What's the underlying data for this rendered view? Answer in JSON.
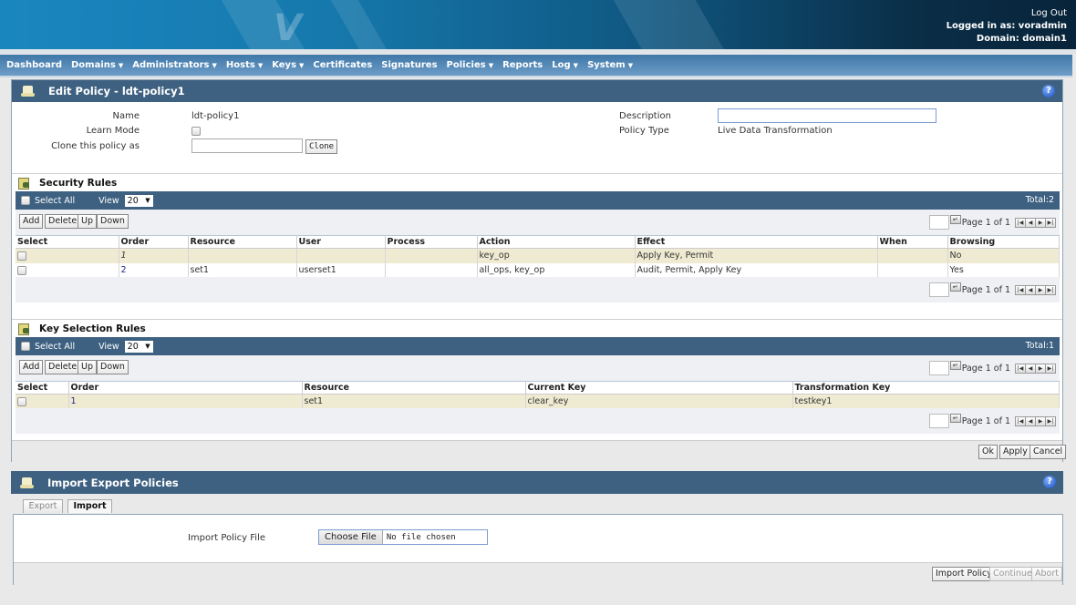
{
  "header": {
    "logout": "Log Out",
    "logged_in": "Logged in as: voradmin",
    "domain": "Domain: domain1"
  },
  "nav": {
    "items": [
      {
        "label": "Dashboard",
        "dropdown": false
      },
      {
        "label": "Domains",
        "dropdown": true
      },
      {
        "label": "Administrators",
        "dropdown": true
      },
      {
        "label": "Hosts",
        "dropdown": true
      },
      {
        "label": "Keys",
        "dropdown": true
      },
      {
        "label": "Certificates",
        "dropdown": false
      },
      {
        "label": "Signatures",
        "dropdown": false
      },
      {
        "label": "Policies",
        "dropdown": true
      },
      {
        "label": "Reports",
        "dropdown": false
      },
      {
        "label": "Log",
        "dropdown": true
      },
      {
        "label": "System",
        "dropdown": true
      }
    ],
    "caret": "▼"
  },
  "edit_policy": {
    "title": "Edit Policy - ldt-policy1",
    "help": "?",
    "name_label": "Name",
    "name_value": "ldt-policy1",
    "learn_mode_label": "Learn Mode",
    "learn_mode_checked": false,
    "clone_label": "Clone this policy as",
    "clone_value": "",
    "clone_button": "Clone",
    "description_label": "Description",
    "description_value": "",
    "policy_type_label": "Policy Type",
    "policy_type_value": "Live Data Transformation"
  },
  "security_rules": {
    "title": "Security Rules",
    "select_all": "Select All",
    "view_label": "View",
    "view_value": "20",
    "total": "Total:2",
    "buttons": {
      "add": "Add",
      "delete": "Delete",
      "up": "Up",
      "down": "Down"
    },
    "pager_text": "Page 1 of 1",
    "columns": [
      "Select",
      "Order",
      "Resource",
      "User",
      "Process",
      "Action",
      "Effect",
      "When",
      "Browsing"
    ],
    "rows": [
      {
        "order": "1",
        "resource": "",
        "user": "",
        "process": "",
        "action": "key_op",
        "effect": "Apply Key, Permit",
        "when": "",
        "browsing": "No"
      },
      {
        "order": "2",
        "resource": "set1",
        "user": "userset1",
        "process": "",
        "action": "all_ops, key_op",
        "effect": "Audit, Permit, Apply Key",
        "when": "",
        "browsing": "Yes"
      }
    ]
  },
  "key_selection_rules": {
    "title": "Key Selection Rules",
    "select_all": "Select All",
    "view_label": "View",
    "view_value": "20",
    "total": "Total:1",
    "buttons": {
      "add": "Add",
      "delete": "Delete",
      "up": "Up",
      "down": "Down"
    },
    "pager_text": "Page 1 of 1",
    "columns": [
      "Select",
      "Order",
      "Resource",
      "Current Key",
      "Transformation Key"
    ],
    "rows": [
      {
        "order": "1",
        "resource": "set1",
        "current_key": "clear_key",
        "transformation_key": "testkey1"
      }
    ]
  },
  "footer_buttons": {
    "ok": "Ok",
    "apply": "Apply",
    "cancel": "Cancel"
  },
  "import_export": {
    "title": "Import Export Policies",
    "help": "?",
    "tabs": [
      {
        "label": "Export",
        "active": false
      },
      {
        "label": "Import",
        "active": true
      }
    ],
    "file_label": "Import Policy File",
    "choose_file": "Choose File",
    "file_status": "No file chosen",
    "import_button": "Import Policy",
    "continue_button": "Continue",
    "abort_button": "Abort"
  },
  "pager_icons": {
    "go": "↵",
    "first": "|◀",
    "prev": "◀",
    "next": "▶",
    "last": "▶|"
  }
}
